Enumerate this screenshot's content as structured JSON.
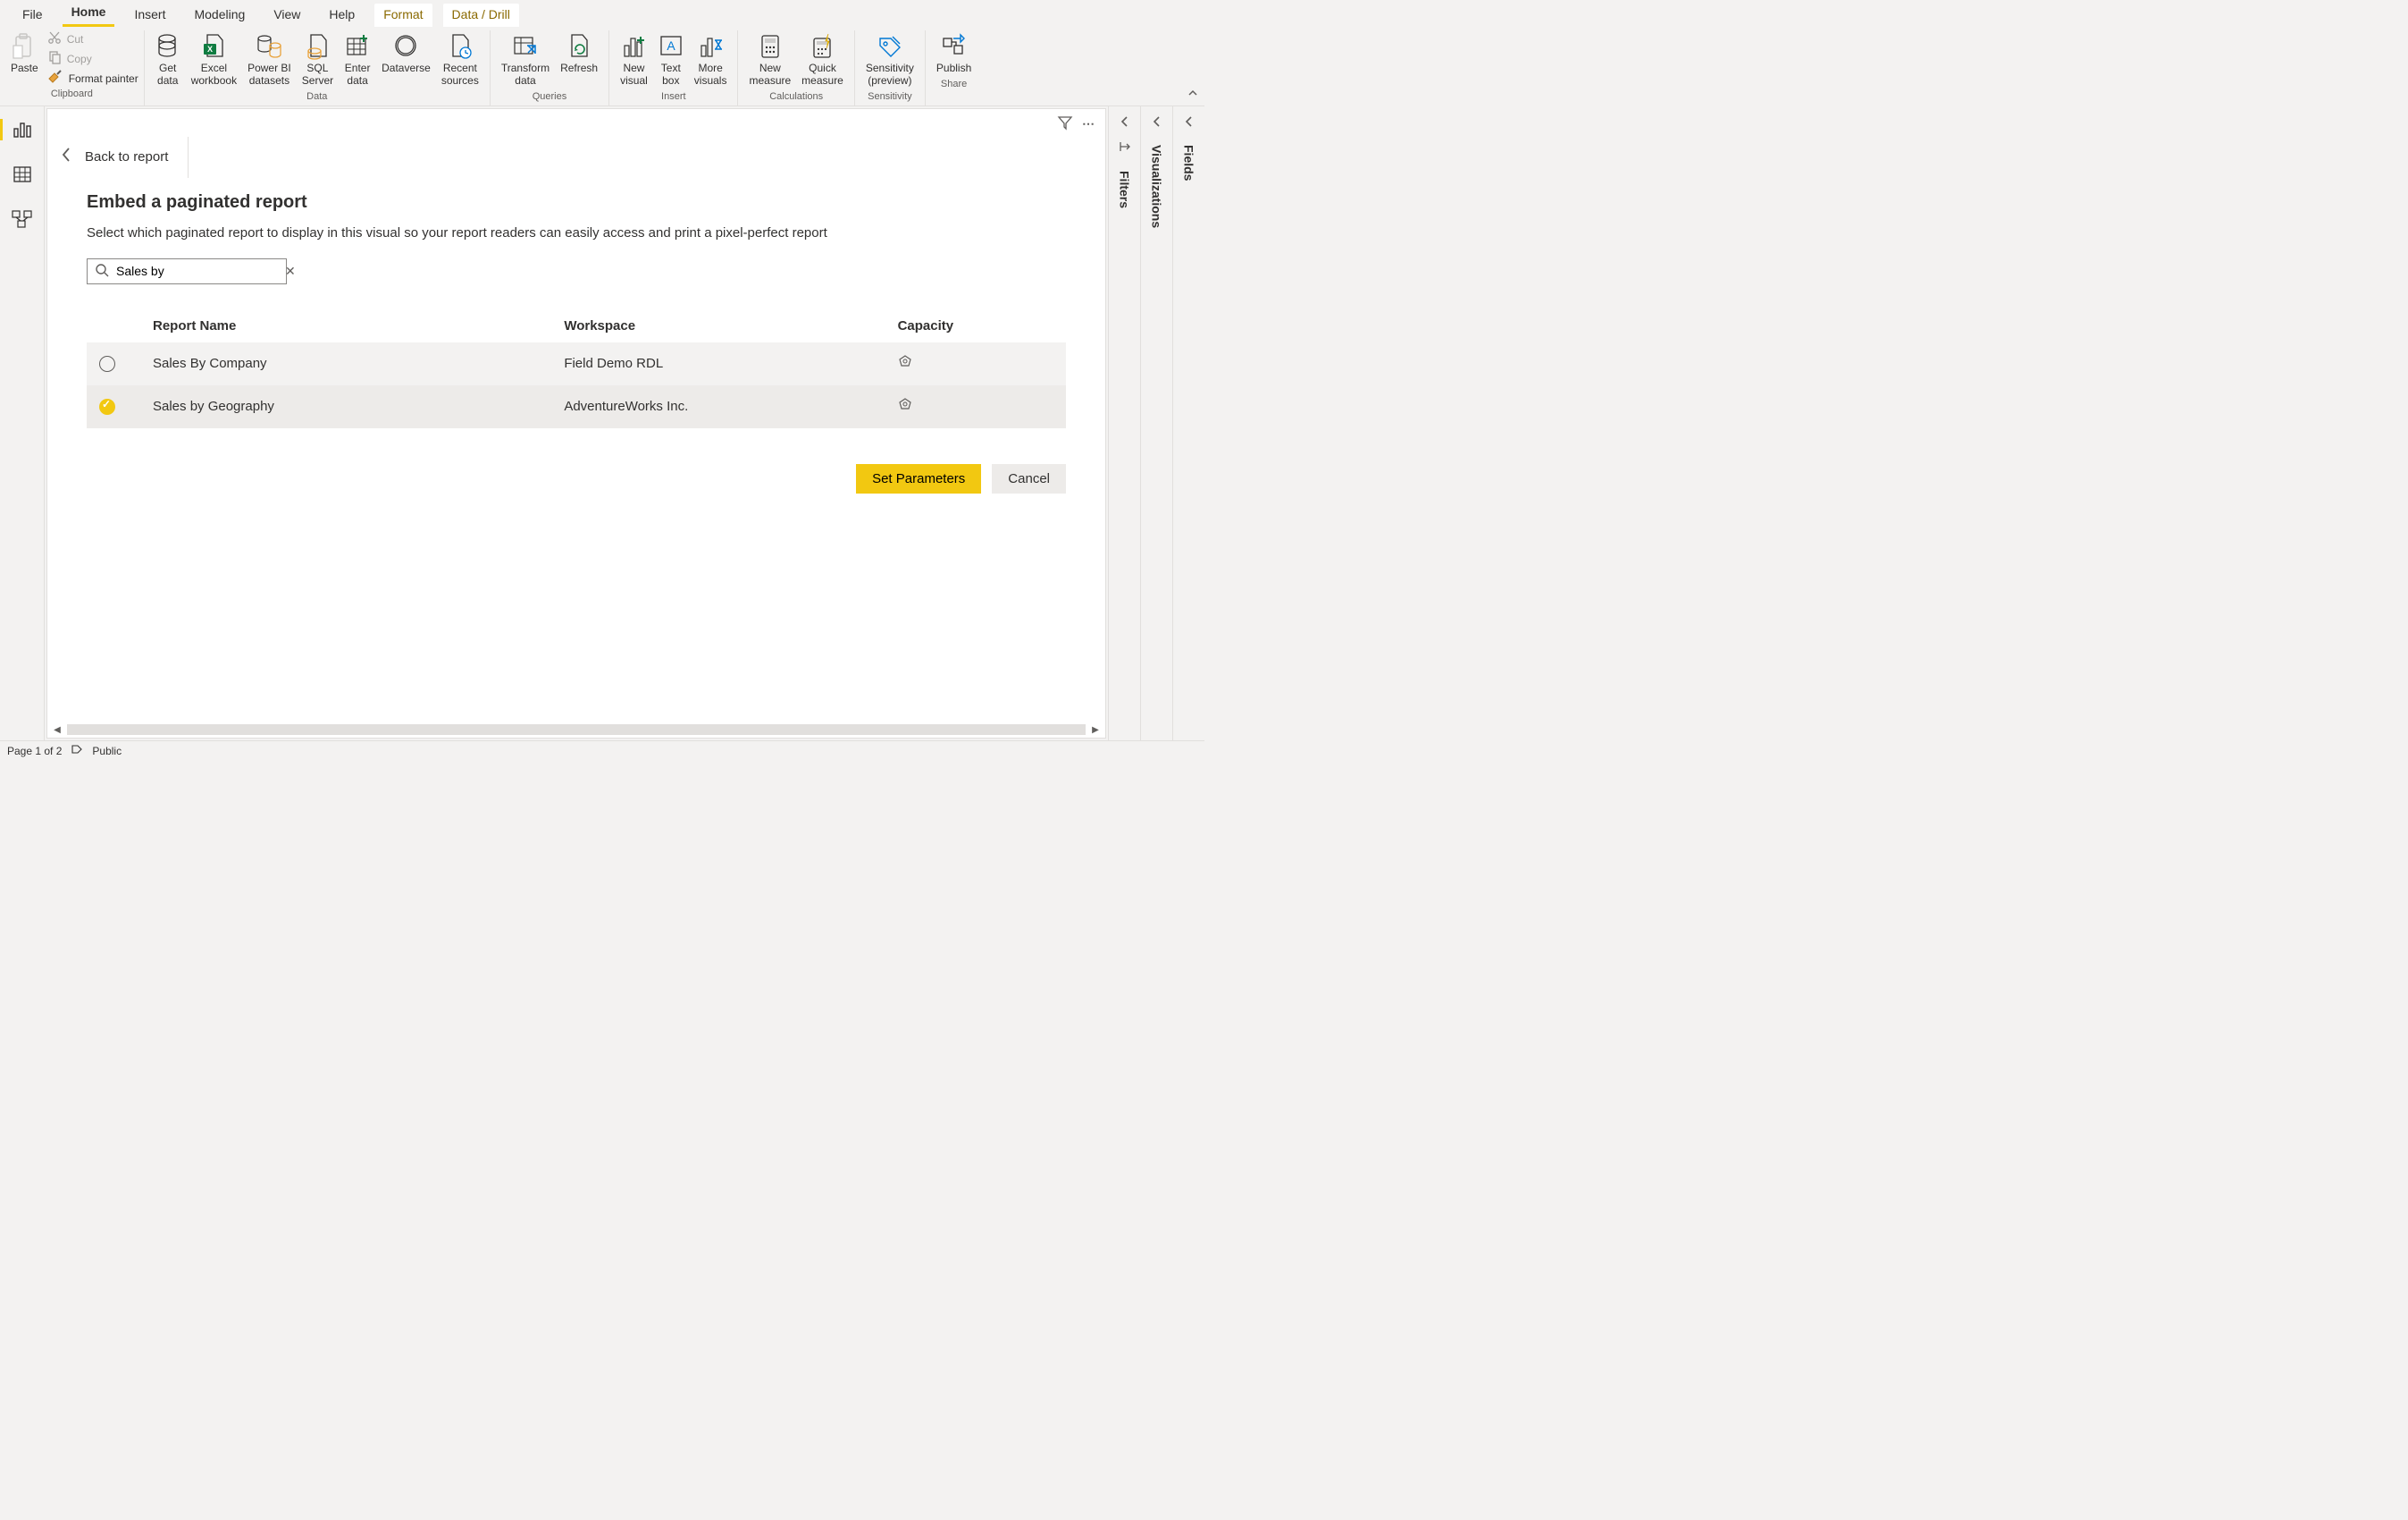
{
  "menubar": {
    "tabs": [
      "File",
      "Home",
      "Insert",
      "Modeling",
      "View",
      "Help",
      "Format",
      "Data / Drill"
    ],
    "active": "Home"
  },
  "ribbon": {
    "clipboard": {
      "paste": "Paste",
      "cut": "Cut",
      "copy": "Copy",
      "format_painter": "Format painter",
      "group": "Clipboard"
    },
    "data": {
      "get_data": "Get\ndata",
      "excel": "Excel\nworkbook",
      "pbi_datasets": "Power BI\ndatasets",
      "sql": "SQL\nServer",
      "enter": "Enter\ndata",
      "dataverse": "Dataverse",
      "recent": "Recent\nsources",
      "group": "Data"
    },
    "queries": {
      "transform": "Transform\ndata",
      "refresh": "Refresh",
      "group": "Queries"
    },
    "insert": {
      "new_visual": "New\nvisual",
      "text_box": "Text\nbox",
      "more_visuals": "More\nvisuals",
      "group": "Insert"
    },
    "calculations": {
      "new_measure": "New\nmeasure",
      "quick_measure": "Quick\nmeasure",
      "group": "Calculations"
    },
    "sensitivity": {
      "sensitivity": "Sensitivity\n(preview)",
      "group": "Sensitivity"
    },
    "share": {
      "publish": "Publish",
      "group": "Share"
    }
  },
  "canvas": {
    "back": "Back to report",
    "title": "Embed a paginated report",
    "subtitle": "Select which paginated report to display in this visual so your report readers can easily access and print a pixel-perfect report",
    "search": {
      "value": "Sales by"
    },
    "table": {
      "cols": {
        "name": "Report Name",
        "workspace": "Workspace",
        "capacity": "Capacity"
      },
      "rows": [
        {
          "selected": false,
          "name": "Sales By Company",
          "workspace": "Field Demo RDL"
        },
        {
          "selected": true,
          "name": "Sales by Geography",
          "workspace": "AdventureWorks Inc."
        }
      ]
    },
    "actions": {
      "set_params": "Set Parameters",
      "cancel": "Cancel"
    }
  },
  "panes": {
    "filters": "Filters",
    "visualizations": "Visualizations",
    "fields": "Fields"
  },
  "status": {
    "page": "Page 1 of 2",
    "sensitivity": "Public"
  }
}
